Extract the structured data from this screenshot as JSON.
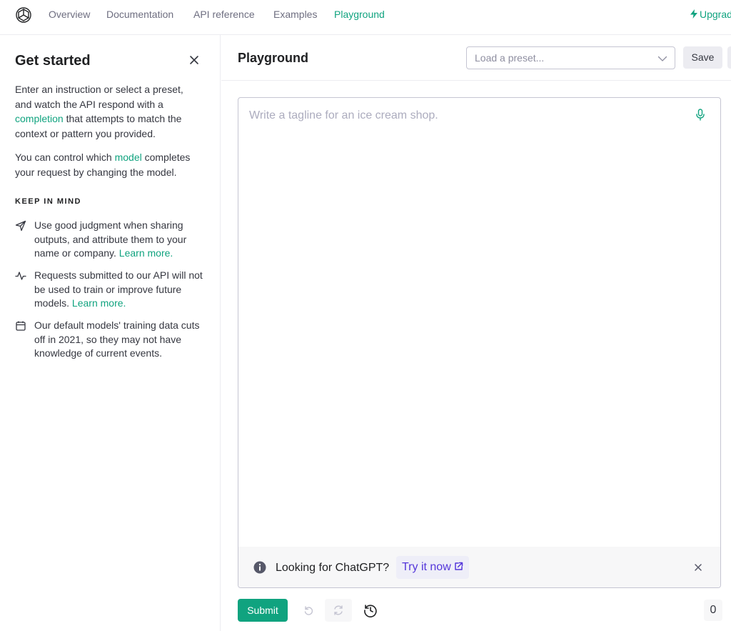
{
  "nav": {
    "links": [
      "Overview",
      "Documentation",
      "API reference",
      "Examples",
      "Playground"
    ],
    "active": "Playground",
    "upgrade_label": "Upgrade"
  },
  "sidebar": {
    "title": "Get started",
    "intro": {
      "p1_a": "Enter an instruction or select a preset, and watch the API respond with a ",
      "p1_link": "completion",
      "p1_b": " that attempts to match the context or pattern you provided.",
      "p2_a": "You can control which ",
      "p2_link": "model",
      "p2_b": " completes your request by changing the model."
    },
    "keep_in_mind_heading": "KEEP IN MIND",
    "tips": [
      {
        "icon": "send-icon",
        "text": "Use good judgment when sharing outputs, and attribute them to your name or company. ",
        "link": "Learn more."
      },
      {
        "icon": "activity-icon",
        "text": "Requests submitted to our API will not be used to train or improve future models. ",
        "link": "Learn more."
      },
      {
        "icon": "calendar-icon",
        "text": "Our default models' training data cuts off in 2021, so they may not have knowledge of current events.",
        "link": ""
      }
    ]
  },
  "main": {
    "title": "Playground",
    "preset_placeholder": "Load a preset...",
    "save_label": "Save",
    "editor_placeholder": "Write a tagline for an ice cream shop.",
    "banner": {
      "text": "Looking for ChatGPT?",
      "cta": "Try it now"
    },
    "submit_label": "Submit",
    "token_count": "0"
  },
  "colors": {
    "accent": "#10a37f",
    "cta": "#5436da",
    "border": "#c5c5d2"
  }
}
